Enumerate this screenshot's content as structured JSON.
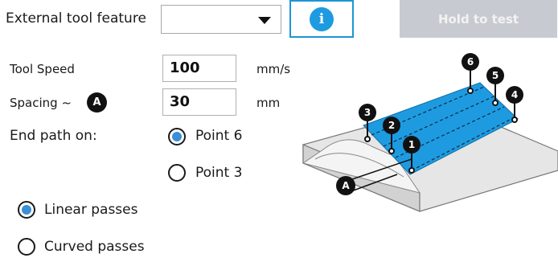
{
  "header": {
    "feature_label": "External tool feature",
    "feature_value": "",
    "info_label": "i",
    "hold_label": "Hold to test"
  },
  "form": {
    "speed_label": "Tool Speed",
    "speed_value": "100",
    "speed_unit": "mm/s",
    "spacing_label": "Spacing ~",
    "spacing_badge": "A",
    "spacing_value": "30",
    "spacing_unit": "mm",
    "end_label": "End path on:",
    "end_options": [
      {
        "label": "Point 6",
        "selected": true
      },
      {
        "label": "Point 3",
        "selected": false
      }
    ],
    "pass_options": [
      {
        "label": "Linear passes",
        "selected": true
      },
      {
        "label": "Curved passes",
        "selected": false
      }
    ]
  },
  "diagram": {
    "points": [
      "1",
      "2",
      "3",
      "4",
      "5",
      "6"
    ],
    "dimension_label": "A",
    "colors": {
      "area": "#1e9be0",
      "part": "#e6e6e6",
      "badge": "#111111"
    }
  }
}
